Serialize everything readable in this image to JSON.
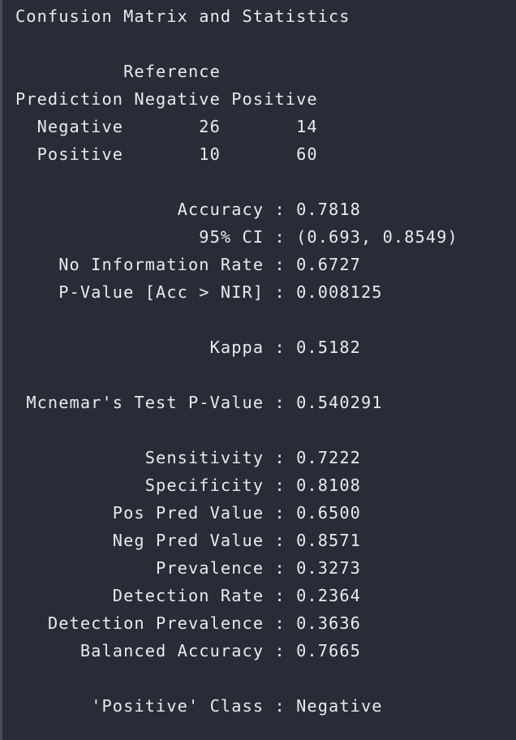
{
  "console": {
    "title": "Confusion Matrix and Statistics",
    "matrix": {
      "reference_label": "Reference",
      "prediction_label": "Prediction",
      "columns": [
        "Negative",
        "Positive"
      ],
      "rows": [
        {
          "label": "Negative",
          "values": [
            "26",
            "14"
          ]
        },
        {
          "label": "Positive",
          "values": [
            "10",
            "60"
          ]
        }
      ]
    },
    "statistics": [
      {
        "label": "Accuracy",
        "value": "0.7818"
      },
      {
        "label": "95% CI",
        "value": "(0.693, 0.8549)"
      },
      {
        "label": "No Information Rate",
        "value": "0.6727"
      },
      {
        "label": "P-Value [Acc > NIR]",
        "value": "0.008125"
      },
      {
        "label": "Kappa",
        "value": "0.5182"
      },
      {
        "label": "Mcnemar's Test P-Value",
        "value": "0.540291"
      },
      {
        "label": "Sensitivity",
        "value": "0.7222"
      },
      {
        "label": "Specificity",
        "value": "0.8108"
      },
      {
        "label": "Pos Pred Value",
        "value": "0.6500"
      },
      {
        "label": "Neg Pred Value",
        "value": "0.8571"
      },
      {
        "label": "Prevalence",
        "value": "0.3273"
      },
      {
        "label": "Detection Rate",
        "value": "0.2364"
      },
      {
        "label": "Detection Prevalence",
        "value": "0.3636"
      },
      {
        "label": "Balanced Accuracy",
        "value": "0.7665"
      },
      {
        "label": "'Positive' Class",
        "value": "Negative"
      }
    ],
    "separator": " : "
  }
}
